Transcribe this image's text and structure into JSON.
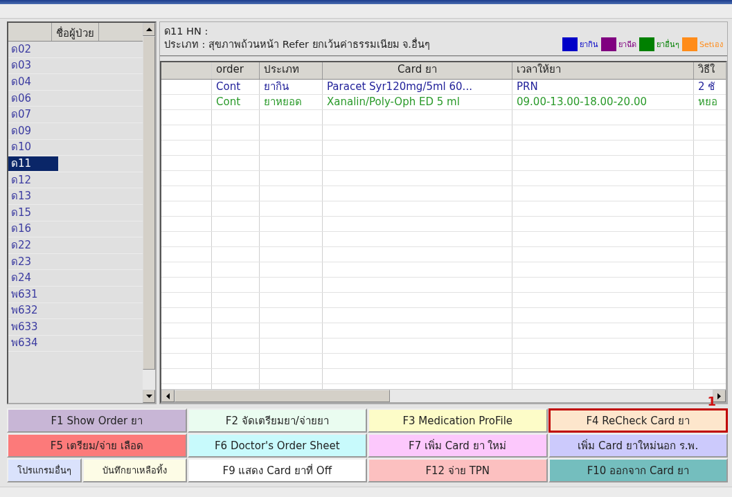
{
  "patients": {
    "header": "ชื่อผู้ป่วย",
    "items": [
      {
        "label": "ด02",
        "selected": false
      },
      {
        "label": "ด03",
        "selected": false
      },
      {
        "label": "ด04",
        "selected": false
      },
      {
        "label": "ด06",
        "selected": false
      },
      {
        "label": "ด07",
        "selected": false
      },
      {
        "label": "ด09",
        "selected": false
      },
      {
        "label": "ด10",
        "selected": false
      },
      {
        "label": "ด11",
        "selected": true
      },
      {
        "label": "ด12",
        "selected": false
      },
      {
        "label": "ด13",
        "selected": false
      },
      {
        "label": "ด15",
        "selected": false
      },
      {
        "label": "ด16",
        "selected": false
      },
      {
        "label": "ด22",
        "selected": false
      },
      {
        "label": "ด23",
        "selected": false
      },
      {
        "label": "ด24",
        "selected": false
      },
      {
        "label": "พ631",
        "selected": false
      },
      {
        "label": "พ632",
        "selected": false
      },
      {
        "label": "พ633",
        "selected": false
      },
      {
        "label": "พ634",
        "selected": false
      }
    ]
  },
  "info": {
    "patient": "ด11  HN :",
    "type": "ประเภท : สุขภาพถ้วนหน้า Refer ยกเว้นค่าธรรมเนียม จ.อื่นๆ"
  },
  "legend": [
    {
      "label": "ยากิน",
      "color": "#0000c8"
    },
    {
      "label": "ยาฉีด",
      "color": "#800080"
    },
    {
      "label": "ยาอื่นๆ",
      "color": "#008000"
    },
    {
      "label": "Setเอง",
      "color": "#ff8c1a"
    }
  ],
  "table": {
    "columns": [
      "order",
      "ประเภท",
      "Card ยา",
      "เวลาให้ยา",
      "วิธีใ"
    ],
    "rows": [
      {
        "color": "#22229a",
        "cells": [
          "Cont",
          "ยากิน",
          "Paracet Syr120mg/5ml 60...",
          "PRN",
          "2 ชั"
        ]
      },
      {
        "color": "#2a9a2a",
        "cells": [
          "Cont",
          "ยาหยอด",
          "Xanalin/Poly-Oph  ED 5 ml",
          "09.00-13.00-18.00-20.00",
          "หยอ"
        ]
      }
    ]
  },
  "annotation": "1",
  "buttons": [
    [
      {
        "label": "F1 Show Order ยา",
        "color": "#c8b6d6",
        "kind": "full",
        "highlighted": false
      },
      {
        "label": "F2 จัดเตรียมยา/จ่ายยา",
        "color": "#eafcf0",
        "kind": "full",
        "highlighted": false
      },
      {
        "label": "F3  Medication ProFile",
        "color": "#fdfcc8",
        "kind": "full",
        "highlighted": false
      },
      {
        "label": "F4  ReCheck Card ยา",
        "color": "#fde6cc",
        "kind": "full",
        "highlighted": true
      }
    ],
    [
      {
        "label": "F5 เตรียม/จ่าย เลือด",
        "color": "#fc7a7a",
        "kind": "full",
        "highlighted": false
      },
      {
        "label": "F6 Doctor's Order Sheet",
        "color": "#c8fafc",
        "kind": "full",
        "highlighted": false
      },
      {
        "label": "F7 เพิ่ม Card ยา ใหม่",
        "color": "#fcc8fc",
        "kind": "full",
        "highlighted": false
      },
      {
        "label": "เพิ่ม Card ยาใหม่นอก ร.พ.",
        "color": "#cccafc",
        "kind": "full",
        "highlighted": false
      }
    ],
    [
      {
        "label": "โปรแกรมอื่นๆ",
        "color": "#dae2fc",
        "kind": "small",
        "highlighted": false
      },
      {
        "label": "บันทึกยาเหลือทิ้ง",
        "color": "#fdfce6",
        "kind": "medium",
        "highlighted": false
      },
      {
        "label": "F9  แสดง Card ยาที่ Off",
        "color": "#ffffff",
        "kind": "full",
        "highlighted": false
      },
      {
        "label": "F12 จ่าย TPN",
        "color": "#fcc0c0",
        "kind": "full",
        "highlighted": false
      },
      {
        "label": "F10 ออกจาก Card ยา",
        "color": "#74bebe",
        "kind": "full",
        "highlighted": false
      }
    ]
  ]
}
